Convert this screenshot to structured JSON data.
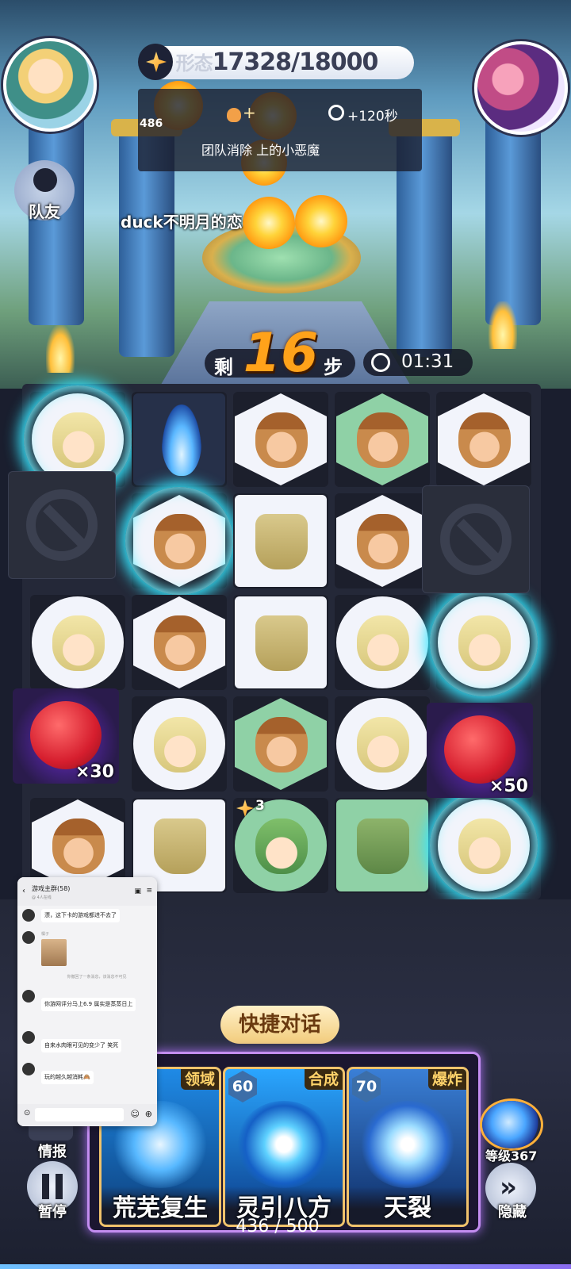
{
  "hud": {
    "score": "17328/18000",
    "score_prefix": "形态",
    "steps_prefix": "剩",
    "steps_value": "16",
    "steps_suffix": "步",
    "timer": "01:31",
    "team_label": "队友",
    "teammate_name": "duck不明月的恋"
  },
  "bonus": {
    "counter": "486",
    "step_bonus": "+",
    "time_bonus": "+120秒",
    "mission": "团队消除        上的小恶魔"
  },
  "board": {
    "devils": [
      {
        "multiplier": "×30"
      },
      {
        "multiplier": "×50"
      }
    ],
    "gem_badge": "3"
  },
  "chat": {
    "title": "游戏主群(58)",
    "subtitle": "@ 4人在线",
    "messages": [
      {
        "name": "",
        "text": "漂，这下卡的游戏都进不去了"
      },
      {
        "name": "橘子",
        "text": ""
      },
      {
        "name": "",
        "text": "你游网评分马上6.9 属实是蒸蒸日上"
      },
      {
        "name": "",
        "text": "自来水肉眼可见的变少了 笑死"
      },
      {
        "name": "",
        "text": "玩的越久越消耗🙈"
      }
    ],
    "system_note": "你撤回了一条消息，该消息不可见"
  },
  "quick_chat": "快捷对话",
  "skills": [
    {
      "name": "荒芜复生",
      "tag": "领域",
      "level": ""
    },
    {
      "name": "灵引八方",
      "tag": "合成",
      "level": "60"
    },
    {
      "name": "天裂",
      "tag": "爆炸",
      "level": "70"
    }
  ],
  "side": {
    "info": "情报",
    "pause": "暂停",
    "level": "等级367",
    "hide": "隐藏"
  },
  "energy": "436 / 500",
  "colors": {
    "accent_gold": "#ffa21a",
    "glow_cyan": "#35e6ff",
    "tray_purple": "#c38df0"
  }
}
